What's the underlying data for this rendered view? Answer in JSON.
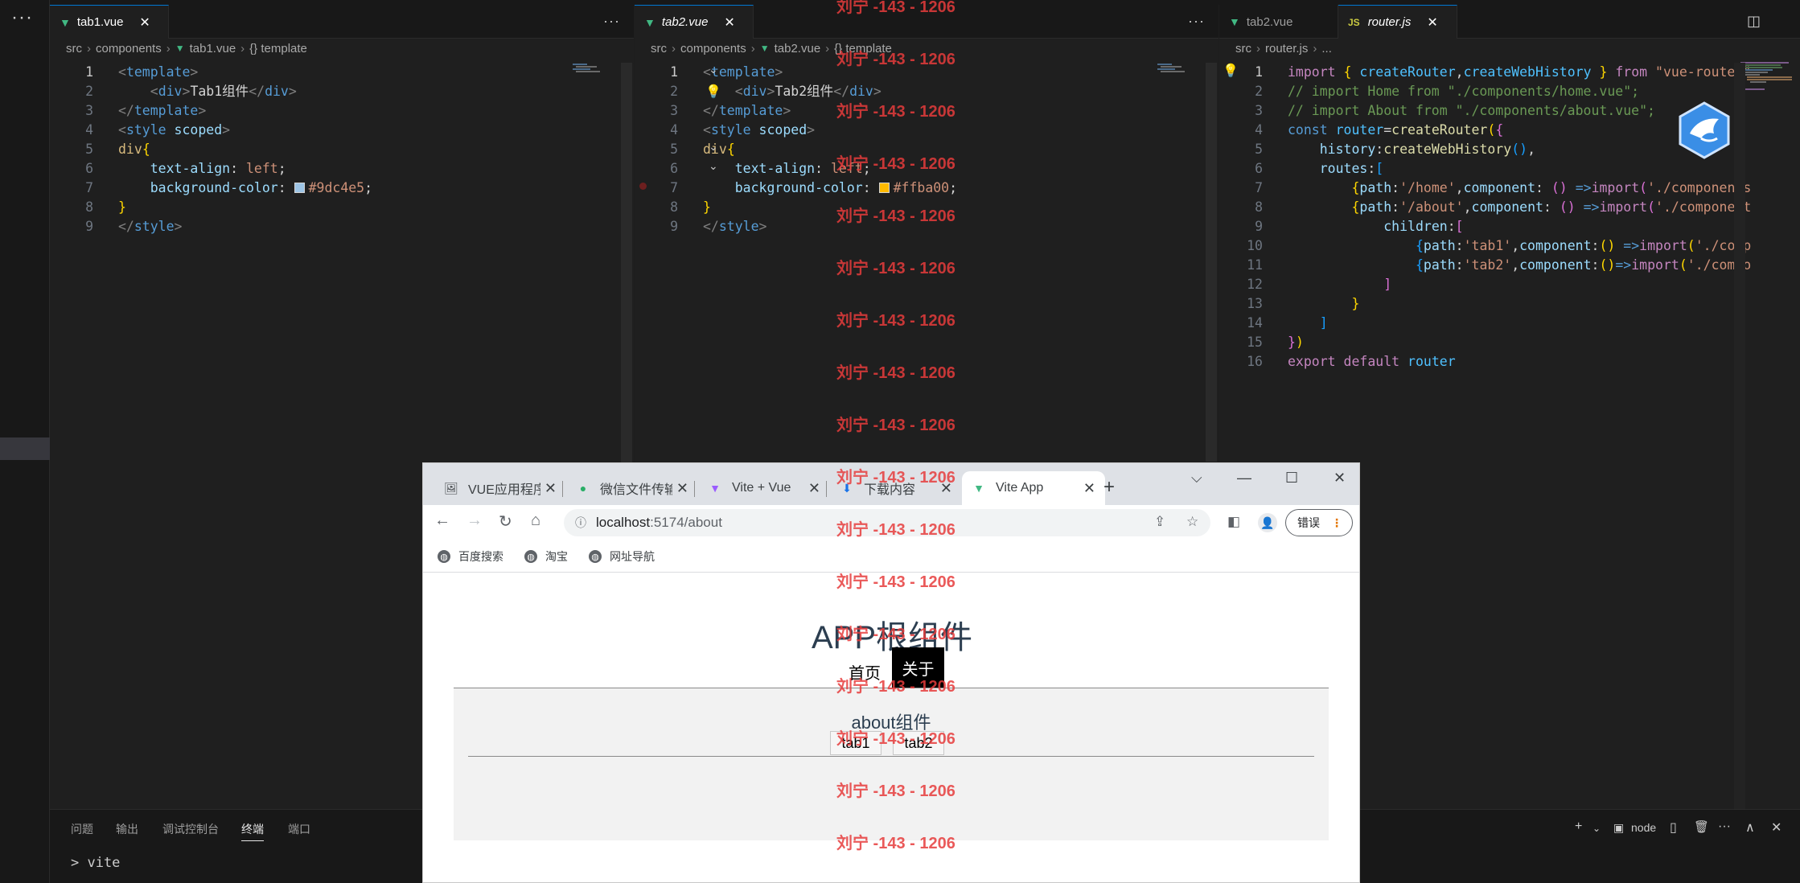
{
  "activity": {
    "more": "···"
  },
  "editor1": {
    "tab": {
      "label": "tab1.vue",
      "close": "✕"
    },
    "more": "···",
    "crumbs": [
      "src",
      "components",
      "tab1.vue",
      "{} template"
    ],
    "lines": [
      {
        "n": "1",
        "parts": [
          [
            "tk-br",
            "<"
          ],
          [
            "tk-tag",
            "template"
          ],
          [
            "tk-br",
            ">"
          ]
        ]
      },
      {
        "n": "2",
        "parts": [
          [
            "tk-txt",
            "    "
          ],
          [
            "tk-br",
            "<"
          ],
          [
            "tk-tag",
            "div"
          ],
          [
            "tk-br",
            ">"
          ],
          [
            "tk-txt",
            "Tab1组件"
          ],
          [
            "tk-br",
            "</"
          ],
          [
            "tk-tag",
            "div"
          ],
          [
            "tk-br",
            ">"
          ]
        ]
      },
      {
        "n": "3",
        "parts": [
          [
            "tk-br",
            "</"
          ],
          [
            "tk-tag",
            "template"
          ],
          [
            "tk-br",
            ">"
          ]
        ]
      },
      {
        "n": "4",
        "parts": [
          [
            "tk-br",
            "<"
          ],
          [
            "tk-tag",
            "style"
          ],
          [
            "tk-txt",
            " "
          ],
          [
            "tk-attr",
            "scoped"
          ],
          [
            "tk-br",
            ">"
          ]
        ]
      },
      {
        "n": "5",
        "parts": [
          [
            "tk-sel",
            "div"
          ],
          [
            "tk-y",
            "{"
          ]
        ]
      },
      {
        "n": "6",
        "parts": [
          [
            "tk-txt",
            "    "
          ],
          [
            "tk-prop",
            "text-align"
          ],
          [
            "tk-txt",
            ": "
          ],
          [
            "tk-val",
            "left"
          ],
          [
            "tk-txt",
            ";"
          ]
        ]
      },
      {
        "n": "7",
        "parts": [
          [
            "tk-txt",
            "    "
          ],
          [
            "tk-prop",
            "background-color"
          ],
          [
            "tk-txt",
            ": "
          ],
          [
            "swatch",
            "#9dc4e5"
          ],
          [
            "tk-val",
            "#9dc4e5"
          ],
          [
            "tk-txt",
            ";"
          ]
        ]
      },
      {
        "n": "8",
        "parts": [
          [
            "tk-y",
            "}"
          ]
        ]
      },
      {
        "n": "9",
        "parts": [
          [
            "tk-br",
            "</"
          ],
          [
            "tk-tag",
            "style"
          ],
          [
            "tk-br",
            ">"
          ]
        ]
      }
    ]
  },
  "editor2": {
    "tab": {
      "label": "tab2.vue",
      "close": "✕"
    },
    "more": "···",
    "crumbs": [
      "src",
      "components",
      "tab2.vue",
      "{} template"
    ],
    "lines": [
      {
        "n": "1",
        "parts": [
          [
            "tk-br",
            "<"
          ],
          [
            "tk-tag",
            "template"
          ],
          [
            "tk-br",
            ">"
          ]
        ]
      },
      {
        "n": "2",
        "parts": [
          [
            "tk-txt",
            "    "
          ],
          [
            "tk-br",
            "<"
          ],
          [
            "tk-tag",
            "div"
          ],
          [
            "tk-br",
            ">"
          ],
          [
            "tk-txt",
            "Tab2组件"
          ],
          [
            "tk-br",
            "</"
          ],
          [
            "tk-tag",
            "div"
          ],
          [
            "tk-br",
            ">"
          ]
        ]
      },
      {
        "n": "3",
        "parts": [
          [
            "tk-br",
            "</"
          ],
          [
            "tk-tag",
            "template"
          ],
          [
            "tk-br",
            ">"
          ]
        ]
      },
      {
        "n": "4",
        "parts": [
          [
            "tk-br",
            "<"
          ],
          [
            "tk-tag",
            "style"
          ],
          [
            "tk-txt",
            " "
          ],
          [
            "tk-attr",
            "scoped"
          ],
          [
            "tk-br",
            ">"
          ]
        ]
      },
      {
        "n": "5",
        "parts": [
          [
            "tk-sel",
            "div"
          ],
          [
            "tk-y",
            "{"
          ]
        ]
      },
      {
        "n": "6",
        "parts": [
          [
            "tk-txt",
            "    "
          ],
          [
            "tk-prop",
            "text-align"
          ],
          [
            "tk-txt",
            ": "
          ],
          [
            "tk-val",
            "left"
          ],
          [
            "tk-txt",
            ";"
          ]
        ]
      },
      {
        "n": "7",
        "parts": [
          [
            "tk-txt",
            "    "
          ],
          [
            "tk-prop",
            "background-color"
          ],
          [
            "tk-txt",
            ": "
          ],
          [
            "swatch",
            "#ffba00"
          ],
          [
            "tk-val",
            "#ffba00"
          ],
          [
            "tk-txt",
            ";"
          ]
        ]
      },
      {
        "n": "8",
        "parts": [
          [
            "tk-y",
            "}"
          ]
        ]
      },
      {
        "n": "9",
        "parts": [
          [
            "tk-br",
            "</"
          ],
          [
            "tk-tag",
            "style"
          ],
          [
            "tk-br",
            ">"
          ]
        ]
      }
    ]
  },
  "editor3": {
    "tab_inactive": {
      "label": "tab2.vue"
    },
    "tab_active": {
      "label": "router.js",
      "badge": "JS",
      "close": "✕"
    },
    "crumbs": [
      "src",
      "router.js",
      "..."
    ],
    "lines": [
      {
        "n": "1",
        "parts": [
          [
            "tk-kw",
            "import"
          ],
          [
            "tk-txt",
            " "
          ],
          [
            "tk-y",
            "{"
          ],
          [
            "tk-txt",
            " "
          ],
          [
            "tk-var",
            "createRouter"
          ],
          [
            "tk-txt",
            ","
          ],
          [
            "tk-var",
            "createWebHistory"
          ],
          [
            "tk-txt",
            " "
          ],
          [
            "tk-y",
            "}"
          ],
          [
            "tk-txt",
            " "
          ],
          [
            "tk-kw",
            "from"
          ],
          [
            "tk-txt",
            " "
          ],
          [
            "tk-str",
            "\"vue-router\""
          ]
        ]
      },
      {
        "n": "2",
        "parts": [
          [
            "tk-cmt",
            "// import Home from \"./components/home.vue\";"
          ]
        ]
      },
      {
        "n": "3",
        "parts": [
          [
            "tk-cmt",
            "// import About from \"./components/about.vue\";"
          ]
        ]
      },
      {
        "n": "4",
        "parts": [
          [
            "tk-kw2",
            "const"
          ],
          [
            "tk-txt",
            " "
          ],
          [
            "tk-var",
            "router"
          ],
          [
            "tk-txt",
            "="
          ],
          [
            "tk-fn",
            "createRouter"
          ],
          [
            "tk-y",
            "("
          ],
          [
            "tk-p",
            "{"
          ]
        ]
      },
      {
        "n": "5",
        "parts": [
          [
            "tk-txt",
            "    "
          ],
          [
            "tk-attr",
            "history"
          ],
          [
            "tk-txt",
            ":"
          ],
          [
            "tk-fn",
            "createWebHistory"
          ],
          [
            "tk-b",
            "()"
          ],
          [
            "tk-txt",
            ","
          ]
        ]
      },
      {
        "n": "6",
        "parts": [
          [
            "tk-txt",
            "    "
          ],
          [
            "tk-attr",
            "routes"
          ],
          [
            "tk-txt",
            ":"
          ],
          [
            "tk-b",
            "["
          ]
        ]
      },
      {
        "n": "7",
        "parts": [
          [
            "tk-txt",
            "        "
          ],
          [
            "tk-y",
            "{"
          ],
          [
            "tk-attr",
            "path"
          ],
          [
            "tk-txt",
            ":"
          ],
          [
            "tk-str",
            "'/home'"
          ],
          [
            "tk-txt",
            ","
          ],
          [
            "tk-attr",
            "component"
          ],
          [
            "tk-txt",
            ": "
          ],
          [
            "tk-p",
            "()"
          ],
          [
            "tk-txt",
            " "
          ],
          [
            "tk-kw2",
            "=>"
          ],
          [
            "tk-kw",
            "import"
          ],
          [
            "tk-p",
            "("
          ],
          [
            "tk-str",
            "'./components"
          ]
        ]
      },
      {
        "n": "8",
        "parts": [
          [
            "tk-txt",
            "        "
          ],
          [
            "tk-y",
            "{"
          ],
          [
            "tk-attr",
            "path"
          ],
          [
            "tk-txt",
            ":"
          ],
          [
            "tk-str",
            "'/about'"
          ],
          [
            "tk-txt",
            ","
          ],
          [
            "tk-attr",
            "component"
          ],
          [
            "tk-txt",
            ": "
          ],
          [
            "tk-p",
            "()"
          ],
          [
            "tk-txt",
            " "
          ],
          [
            "tk-kw2",
            "=>"
          ],
          [
            "tk-kw",
            "import"
          ],
          [
            "tk-p",
            "("
          ],
          [
            "tk-str",
            "'./component"
          ]
        ]
      },
      {
        "n": "9",
        "parts": [
          [
            "tk-txt",
            "            "
          ],
          [
            "tk-attr",
            "children"
          ],
          [
            "tk-txt",
            ":"
          ],
          [
            "tk-p",
            "["
          ]
        ]
      },
      {
        "n": "10",
        "parts": [
          [
            "tk-txt",
            "                "
          ],
          [
            "tk-b",
            "{"
          ],
          [
            "tk-attr",
            "path"
          ],
          [
            "tk-txt",
            ":"
          ],
          [
            "tk-str",
            "'tab1'"
          ],
          [
            "tk-txt",
            ","
          ],
          [
            "tk-attr",
            "component"
          ],
          [
            "tk-txt",
            ":"
          ],
          [
            "tk-y",
            "()"
          ],
          [
            "tk-txt",
            " "
          ],
          [
            "tk-kw2",
            "=>"
          ],
          [
            "tk-kw",
            "import"
          ],
          [
            "tk-y",
            "("
          ],
          [
            "tk-str",
            "'./comp"
          ]
        ]
      },
      {
        "n": "11",
        "parts": [
          [
            "tk-txt",
            "                "
          ],
          [
            "tk-b",
            "{"
          ],
          [
            "tk-attr",
            "path"
          ],
          [
            "tk-txt",
            ":"
          ],
          [
            "tk-str",
            "'tab2'"
          ],
          [
            "tk-txt",
            ","
          ],
          [
            "tk-attr",
            "component"
          ],
          [
            "tk-txt",
            ":"
          ],
          [
            "tk-y",
            "()"
          ],
          [
            "tk-kw2",
            "=>"
          ],
          [
            "tk-kw",
            "import"
          ],
          [
            "tk-y",
            "("
          ],
          [
            "tk-str",
            "'./compo"
          ]
        ]
      },
      {
        "n": "12",
        "parts": [
          [
            "tk-txt",
            "            "
          ],
          [
            "tk-p",
            "]"
          ]
        ]
      },
      {
        "n": "13",
        "parts": [
          [
            "tk-txt",
            "        "
          ],
          [
            "tk-y",
            "}"
          ]
        ]
      },
      {
        "n": "14",
        "parts": [
          [
            "tk-txt",
            "    "
          ],
          [
            "tk-b",
            "]"
          ]
        ]
      },
      {
        "n": "15",
        "parts": [
          [
            "tk-p",
            "}"
          ],
          [
            "tk-y",
            ")"
          ]
        ]
      },
      {
        "n": "16",
        "parts": [
          [
            "tk-kw",
            "export"
          ],
          [
            "tk-txt",
            " "
          ],
          [
            "tk-kw",
            "default"
          ],
          [
            "tk-txt",
            " "
          ],
          [
            "tk-var",
            "router"
          ]
        ]
      }
    ]
  },
  "panel": {
    "tabs": [
      "问题",
      "输出",
      "调试控制台",
      "终端",
      "端口"
    ],
    "active_tab": "终端",
    "prompt": "> vite",
    "terminal_name": "node",
    "actions": {
      "add": "+",
      "split": "▯",
      "trash": "🗑",
      "more": "···",
      "up": "∧",
      "close": "✕"
    }
  },
  "browser": {
    "tabs": [
      {
        "label": "VUE应用程序",
        "icon": "image-icon"
      },
      {
        "label": "微信文件传输",
        "icon": "wechat-icon"
      },
      {
        "label": "Vite + Vue",
        "icon": "vite-icon"
      },
      {
        "label": "下载内容",
        "icon": "download-icon"
      },
      {
        "label": "Vite App",
        "icon": "vue-icon",
        "active": true
      }
    ],
    "new_tab": "+",
    "tab_close": "✕",
    "window": {
      "dropdown": "⌵",
      "minimize": "—",
      "maximize": "☐",
      "close": "✕"
    },
    "url_host": "localhost",
    "url_path": ":5174/about",
    "error_button": "错误",
    "bookmarks": [
      "百度搜索",
      "淘宝",
      "网址导航"
    ]
  },
  "page": {
    "title": "APP根组件",
    "nav": {
      "home": "首页",
      "about": "关于"
    },
    "about_title": "about组件",
    "subtabs": [
      "tab1",
      "tab2"
    ]
  },
  "watermark": "刘宁 -143 - 1206",
  "colors": {
    "tab1_swatch": "#9dc4e5",
    "tab2_swatch": "#ffba00",
    "vue_green": "#41b883",
    "accent": "#0078d4"
  }
}
